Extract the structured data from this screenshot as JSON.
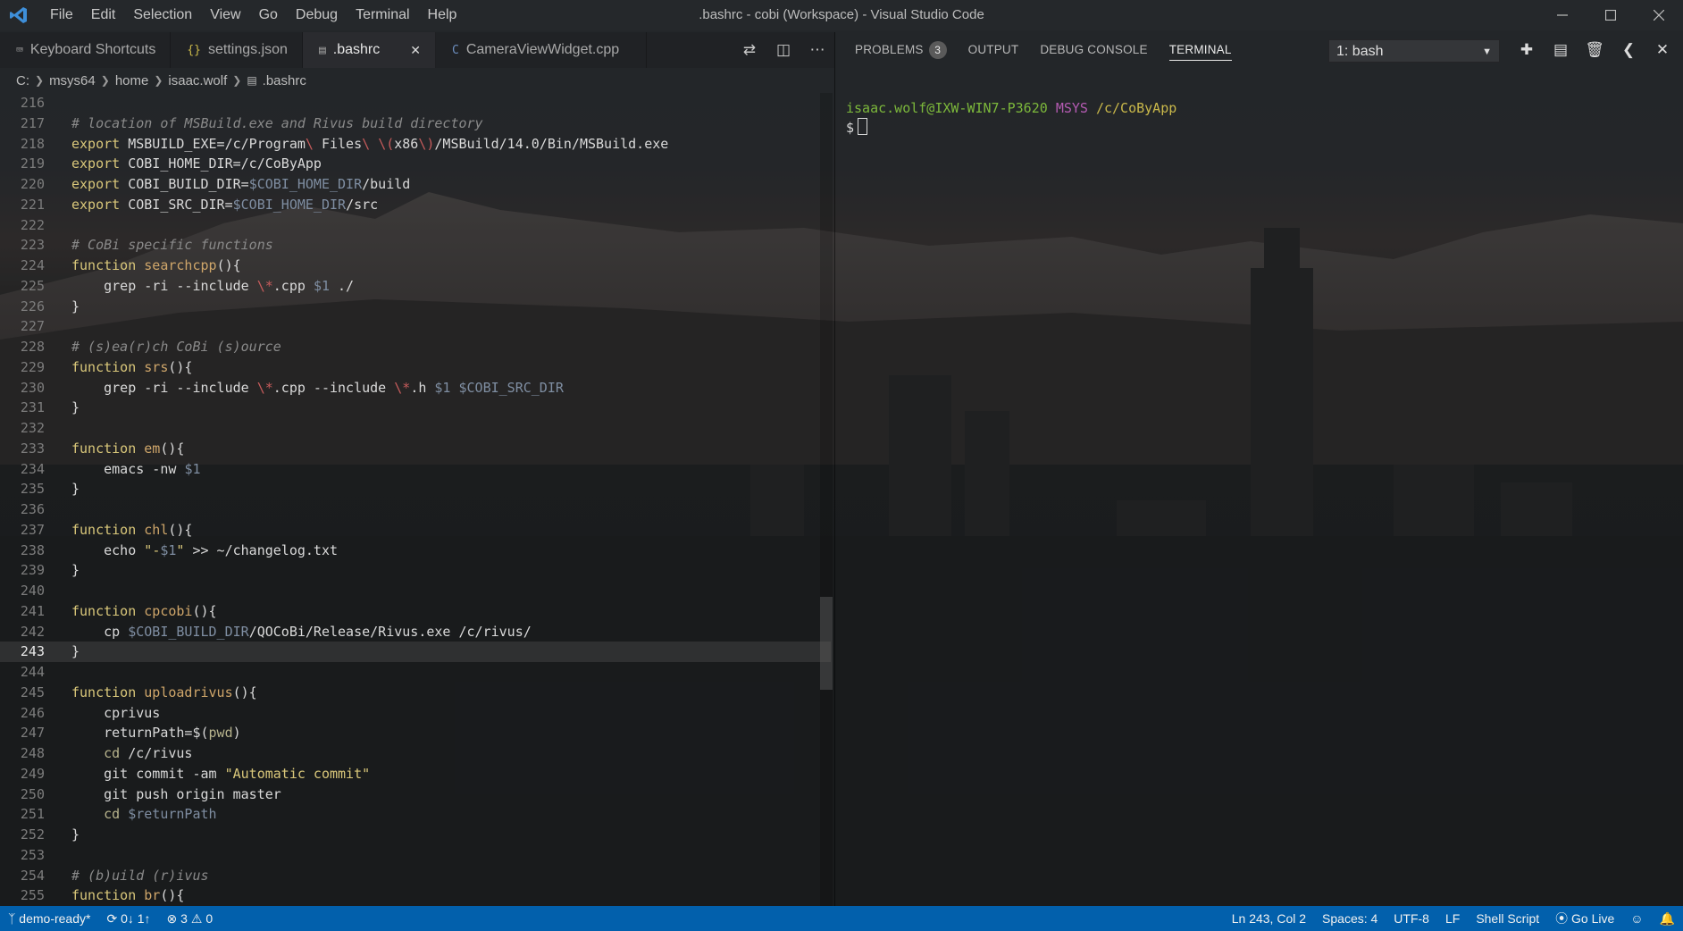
{
  "window": {
    "title": ".bashrc - cobi (Workspace) - Visual Studio Code"
  },
  "menu": [
    "File",
    "Edit",
    "Selection",
    "View",
    "Go",
    "Debug",
    "Terminal",
    "Help"
  ],
  "tabs": [
    {
      "label": "Keyboard Shortcuts",
      "icon": "keyboard-icon"
    },
    {
      "label": "settings.json",
      "icon": "json-braces-icon"
    },
    {
      "label": ".bashrc",
      "icon": "file-icon",
      "active": true
    },
    {
      "label": "CameraViewWidget.cpp",
      "icon": "cpp-icon"
    }
  ],
  "breadcrumb": [
    "C:",
    "msys64",
    "home",
    "isaac.wolf",
    ".bashrc"
  ],
  "editor": {
    "current_line": 243,
    "lines": [
      {
        "n": "216",
        "t": ""
      },
      {
        "n": "217",
        "t": "# location of MSBuild.exe and Rivus build directory"
      },
      {
        "n": "218",
        "t": "export MSBUILD_EXE=/c/Program\\ Files\\ \\(x86\\)/MSBuild/14.0/Bin/MSBuild.exe"
      },
      {
        "n": "219",
        "t": "export COBI_HOME_DIR=/c/CoByApp"
      },
      {
        "n": "220",
        "t": "export COBI_BUILD_DIR=$COBI_HOME_DIR/build"
      },
      {
        "n": "221",
        "t": "export COBI_SRC_DIR=$COBI_HOME_DIR/src"
      },
      {
        "n": "222",
        "t": ""
      },
      {
        "n": "223",
        "t": "# CoBi specific functions"
      },
      {
        "n": "224",
        "t": "function searchcpp(){"
      },
      {
        "n": "225",
        "t": "    grep -ri --include \\*.cpp $1 ./"
      },
      {
        "n": "226",
        "t": "}"
      },
      {
        "n": "227",
        "t": ""
      },
      {
        "n": "228",
        "t": "# (s)ea(r)ch CoBi (s)ource"
      },
      {
        "n": "229",
        "t": "function srs(){"
      },
      {
        "n": "230",
        "t": "    grep -ri --include \\*.cpp --include \\*.h $1 $COBI_SRC_DIR"
      },
      {
        "n": "231",
        "t": "}"
      },
      {
        "n": "232",
        "t": ""
      },
      {
        "n": "233",
        "t": "function em(){"
      },
      {
        "n": "234",
        "t": "    emacs -nw $1"
      },
      {
        "n": "235",
        "t": "}"
      },
      {
        "n": "236",
        "t": ""
      },
      {
        "n": "237",
        "t": "function chl(){"
      },
      {
        "n": "238",
        "t": "    echo \"-$1\" >> ~/changelog.txt"
      },
      {
        "n": "239",
        "t": "}"
      },
      {
        "n": "240",
        "t": ""
      },
      {
        "n": "241",
        "t": "function cpcobi(){"
      },
      {
        "n": "242",
        "t": "    cp $COBI_BUILD_DIR/QOCoBi/Release/Rivus.exe /c/rivus/"
      },
      {
        "n": "243",
        "t": "}"
      },
      {
        "n": "244",
        "t": ""
      },
      {
        "n": "245",
        "t": "function uploadrivus(){"
      },
      {
        "n": "246",
        "t": "    cprivus"
      },
      {
        "n": "247",
        "t": "    returnPath=$(pwd)"
      },
      {
        "n": "248",
        "t": "    cd /c/rivus"
      },
      {
        "n": "249",
        "t": "    git commit -am \"Automatic commit\""
      },
      {
        "n": "250",
        "t": "    git push origin master"
      },
      {
        "n": "251",
        "t": "    cd $returnPath"
      },
      {
        "n": "252",
        "t": "}"
      },
      {
        "n": "253",
        "t": ""
      },
      {
        "n": "254",
        "t": "# (b)uild (r)ivus"
      },
      {
        "n": "255",
        "t": "function br(){"
      }
    ]
  },
  "panel": {
    "tabs": [
      "PROBLEMS",
      "OUTPUT",
      "DEBUG CONSOLE",
      "TERMINAL"
    ],
    "problems_count": "3",
    "active_tab": "TERMINAL",
    "terminal_select": "1: bash"
  },
  "terminal": {
    "user": "isaac.wolf@IXW-WIN7-P3620",
    "shell": "MSYS",
    "path": "/c/CoByApp",
    "prompt": "$"
  },
  "statusbar": {
    "branch": "demo-ready*",
    "sync": "0↓ 1↑",
    "errors": "3",
    "warnings": "0",
    "position": "Ln 243, Col 2",
    "spaces": "Spaces: 4",
    "encoding": "UTF-8",
    "eol": "LF",
    "language": "Shell Script",
    "golive": "Go Live"
  },
  "colors": {
    "status_bar": "#0066b8",
    "accent_blue": "#3e8fd9"
  }
}
